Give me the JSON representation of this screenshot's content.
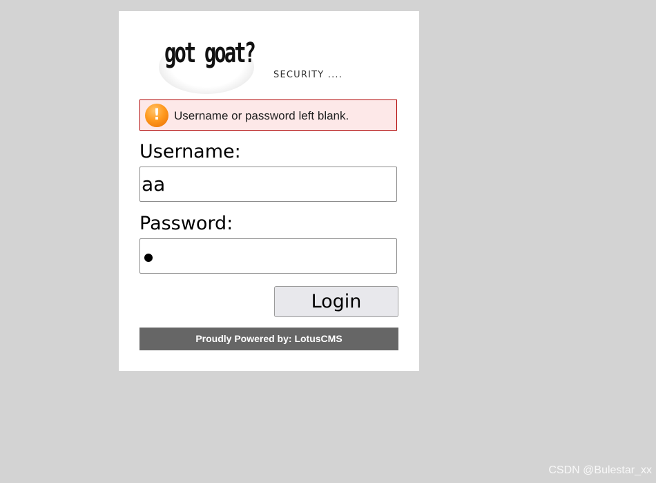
{
  "logo": {
    "text": "got goat?",
    "tagline": "SECURITY ...."
  },
  "error": {
    "icon": "exclamation-icon",
    "icon_glyph": "!",
    "message": "Username or password left blank."
  },
  "form": {
    "username_label": "Username:",
    "username_value": "aa",
    "password_label": "Password:",
    "password_masked": "●",
    "login_label": "Login"
  },
  "footer": {
    "powered_by": "Proudly Powered by: LotusCMS"
  },
  "watermark": "CSDN @Bulestar_xx",
  "colors": {
    "page_background": "#d3d3d3",
    "panel_background": "#ffffff",
    "error_background": "#fde8e8",
    "error_border": "#b00000",
    "footer_background": "#666666",
    "warning_orange": "#ff9a1f"
  }
}
